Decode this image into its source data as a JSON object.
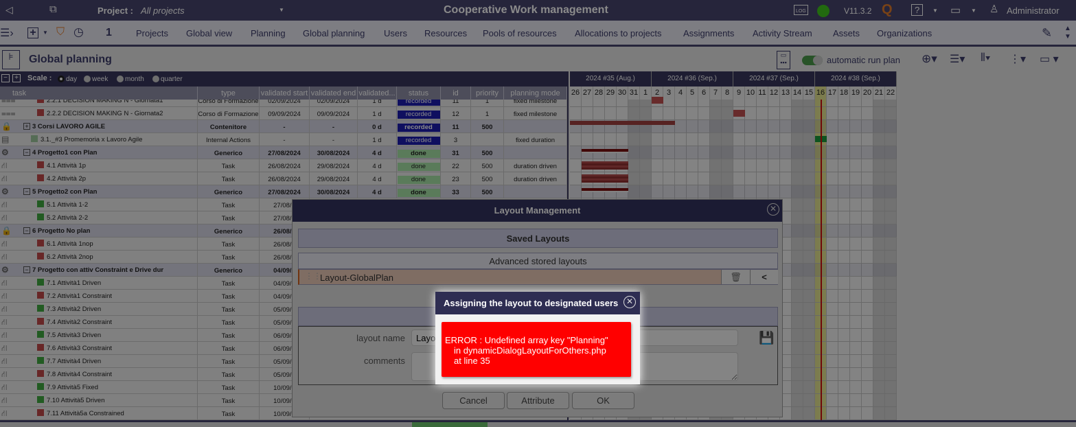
{
  "topbar": {
    "project_label": "Project :",
    "project_value": "All projects",
    "app_title": "Cooperative Work management",
    "version": "V11.3.2",
    "log": "LOG",
    "user": "Administrator"
  },
  "navbar": {
    "counter": "1",
    "items": [
      "Projects",
      "Global view",
      "Planning",
      "Global planning",
      "Users",
      "Resources",
      "Pools of resources",
      "Allocations to projects",
      "Assignments",
      "Activity Stream",
      "Assets",
      "Organizations"
    ]
  },
  "titlebar": {
    "title": "Global planning",
    "auto_run": "automatic run plan"
  },
  "scale": {
    "label": "Scale :",
    "options": [
      "day",
      "week",
      "month",
      "quarter"
    ],
    "selected": "day"
  },
  "columns": [
    "task",
    "type",
    "validated start",
    "validated end",
    "validated...",
    "status",
    "id",
    "priority",
    "planning mode"
  ],
  "rows": [
    {
      "icon": "calendar",
      "color": "#c04848",
      "label": "2.2.1 DECISION MAKING N - Giornata1",
      "indent": 2,
      "type": "Corso di Formazione",
      "vstart": "02/09/2024",
      "vend": "02/09/2024",
      "vdur": "1 d",
      "status": "recorded",
      "id": "11",
      "priority": "1",
      "mode": "fixed milestone",
      "bar": {
        "from": "2024-09-02",
        "to": "2024-09-02",
        "kind": "ms"
      }
    },
    {
      "icon": "calendar",
      "color": "#c04848",
      "label": "2.2.2 DECISION MAKING N - Giornata2",
      "indent": 2,
      "type": "Corso di Formazione",
      "vstart": "09/09/2024",
      "vend": "09/09/2024",
      "vdur": "1 d",
      "status": "recorded",
      "id": "12",
      "priority": "1",
      "mode": "fixed milestone",
      "bar": {
        "from": "2024-09-09",
        "to": "2024-09-09",
        "kind": "ms"
      }
    },
    {
      "icon": "lock",
      "group": true,
      "exp": "+",
      "label": "3 Corsi LAVORO AGILE",
      "type": "Contenitore",
      "vstart": "-",
      "vend": "-",
      "vdur": "0 d",
      "status": "recorded",
      "id": "11",
      "priority": "500",
      "mode": "",
      "bar": {
        "from": "2024-08-20",
        "to": "2024-09-03",
        "kind": "sum"
      }
    },
    {
      "icon": "doc",
      "color": "#9ec89e",
      "label": "3.1._#3 Promemoria x Lavoro Agile",
      "indent": 1,
      "type": "Internal Actions",
      "vstart": "-",
      "vend": "-",
      "vdur": "1 d",
      "status": "recorded",
      "id": "3",
      "priority": "",
      "mode": "fixed duration",
      "bar": {
        "from": "2024-09-16",
        "to": "2024-09-16",
        "kind": "flag"
      }
    },
    {
      "icon": "gear",
      "group": true,
      "exp": "−",
      "label": "4 Progetto1 con Plan",
      "type": "Generico",
      "vstart": "27/08/2024",
      "vend": "30/08/2024",
      "vdur": "4 d",
      "status": "done",
      "id": "31",
      "priority": "500",
      "mode": "",
      "bar": {
        "from": "2024-08-27",
        "to": "2024-08-30",
        "kind": "grp"
      }
    },
    {
      "icon": "tree",
      "color": "#c04848",
      "label": "4.1 Attività 1p",
      "indent": 2,
      "type": "Task",
      "vstart": "26/08/2024",
      "vend": "29/08/2024",
      "vdur": "4 d",
      "status": "done",
      "id": "22",
      "priority": "500",
      "mode": "duration driven",
      "bar": {
        "from": "2024-08-27",
        "to": "2024-08-30",
        "kind": "task"
      }
    },
    {
      "icon": "tree",
      "color": "#c04848",
      "label": "4.2 Attività 2p",
      "indent": 2,
      "type": "Task",
      "vstart": "26/08/2024",
      "vend": "29/08/2024",
      "vdur": "4 d",
      "status": "done",
      "id": "23",
      "priority": "500",
      "mode": "duration driven",
      "bar": {
        "from": "2024-08-27",
        "to": "2024-08-30",
        "kind": "task"
      }
    },
    {
      "icon": "gear",
      "group": true,
      "exp": "−",
      "label": "5 Progetto2 con Plan",
      "type": "Generico",
      "vstart": "27/08/2024",
      "vend": "30/08/2024",
      "vdur": "4 d",
      "status": "done",
      "id": "33",
      "priority": "500",
      "mode": "",
      "bar": {
        "from": "2024-08-27",
        "to": "2024-08-30",
        "kind": "grp"
      }
    },
    {
      "icon": "tree",
      "color": "#3fa83f",
      "label": "5.1 Attività 1-2",
      "indent": 2,
      "type": "Task",
      "vstart": "27/08/2"
    },
    {
      "icon": "tree",
      "color": "#3fa83f",
      "label": "5.2 Attività 2-2",
      "indent": 2,
      "type": "Task",
      "vstart": "27/08/2"
    },
    {
      "icon": "lock",
      "group": true,
      "exp": "−",
      "label": "6 Progetto No plan",
      "type": "Generico",
      "vstart": "26/08/2"
    },
    {
      "icon": "tree",
      "color": "#c04848",
      "label": "6.1 Attività 1nop",
      "indent": 2,
      "type": "Task",
      "vstart": "26/08/2"
    },
    {
      "icon": "tree",
      "color": "#c04848",
      "label": "6.2 Attività 2nop",
      "indent": 2,
      "type": "Task",
      "vstart": "26/08/2"
    },
    {
      "icon": "gear",
      "group": true,
      "exp": "−",
      "label": "7 Progetto con attiv Constraint e Drive dur",
      "type": "Generico",
      "vstart": "04/09/2"
    },
    {
      "icon": "tree",
      "color": "#3fa83f",
      "label": "7.1 Attività1 Driven",
      "indent": 2,
      "type": "Task",
      "vstart": "04/09/2"
    },
    {
      "icon": "tree",
      "color": "#c04848",
      "label": "7.2 Attività1 Constraint",
      "indent": 2,
      "type": "Task",
      "vstart": "04/09/2"
    },
    {
      "icon": "tree",
      "color": "#3fa83f",
      "label": "7.3 Attività2 Driven",
      "indent": 2,
      "type": "Task",
      "vstart": "05/09/2"
    },
    {
      "icon": "tree",
      "color": "#c04848",
      "label": "7.4 Attività2 Constraint",
      "indent": 2,
      "type": "Task",
      "vstart": "05/09/2"
    },
    {
      "icon": "tree",
      "color": "#3fa83f",
      "label": "7.5 Attività3 Driven",
      "indent": 2,
      "type": "Task",
      "vstart": "06/09/2"
    },
    {
      "icon": "tree",
      "color": "#c04848",
      "label": "7.6 Attività3 Constraint",
      "indent": 2,
      "type": "Task",
      "vstart": "06/09/2"
    },
    {
      "icon": "tree",
      "color": "#3fa83f",
      "label": "7.7 Attività4 Driven",
      "indent": 2,
      "type": "Task",
      "vstart": "05/09/2"
    },
    {
      "icon": "tree",
      "color": "#c04848",
      "label": "7.8 Attività4 Constraint",
      "indent": 2,
      "type": "Task",
      "vstart": "05/09/2"
    },
    {
      "icon": "tree",
      "color": "#3fa83f",
      "label": "7.9 Attività5 Fixed",
      "indent": 2,
      "type": "Task",
      "vstart": "10/09/2"
    },
    {
      "icon": "tree",
      "color": "#3fa83f",
      "label": "7.10 Attività5 Driven",
      "indent": 2,
      "type": "Task",
      "vstart": "10/09/2"
    },
    {
      "icon": "tree",
      "color": "#c04848",
      "label": "7.11 Attività5a Constrained",
      "indent": 2,
      "type": "Task",
      "vstart": "10/09/2"
    }
  ],
  "gantt": {
    "start_date": "2024-08-26",
    "today": "2024-09-16",
    "weeks": [
      "2024 #35 (Aug.)",
      "2024 #36 (Sep.)",
      "2024 #37 (Sep.)",
      "2024 #38 (Sep.)"
    ],
    "days": [
      "26",
      "27",
      "28",
      "29",
      "30",
      "31",
      "1",
      "2",
      "3",
      "4",
      "5",
      "6",
      "7",
      "8",
      "9",
      "10",
      "11",
      "12",
      "13",
      "14",
      "15",
      "16",
      "17",
      "18",
      "19",
      "20",
      "21",
      "22"
    ],
    "weekend_days": [
      "31",
      "1",
      "7",
      "8",
      "14",
      "15",
      "21",
      "22"
    ]
  },
  "layout_dialog": {
    "title": "Layout Management",
    "saved_layouts": "Saved Layouts",
    "advanced": "Advanced stored layouts",
    "layout_item": "Layout-GlobalPlan",
    "layout_name_label": "layout name",
    "layout_name_value": "Layout-GlobalPlan",
    "comments_label": "comments",
    "cancel": "Cancel",
    "attribute": "Attribute",
    "ok": "OK"
  },
  "error_dialog": {
    "title": "Assigning the layout to designated users",
    "line1": "ERROR : Undefined array key \"Planning\"",
    "line2": "in dynamicDialogLayoutForOthers.php",
    "line3": "at line 35"
  }
}
